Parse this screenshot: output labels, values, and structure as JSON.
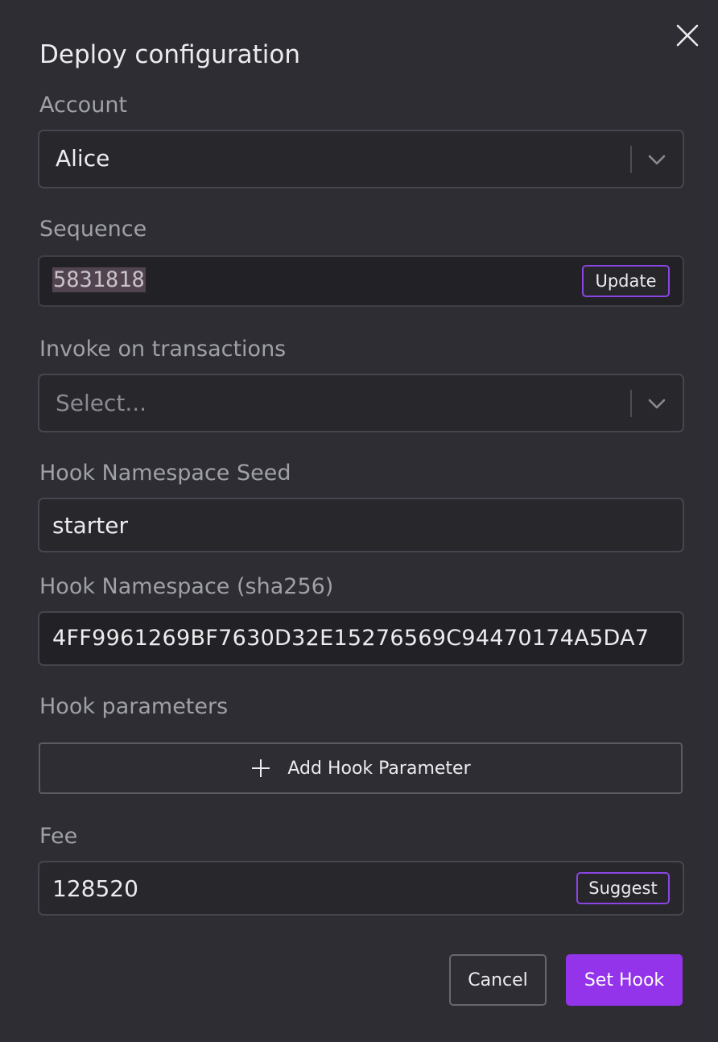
{
  "dialog": {
    "title": "Deploy configuration",
    "close_icon": "close-icon"
  },
  "account": {
    "label": "Account",
    "value": "Alice",
    "icon": "chevron-down-icon"
  },
  "sequence": {
    "label": "Sequence",
    "value": "5831818",
    "button_label": "Update"
  },
  "invoke": {
    "label": "Invoke on transactions",
    "placeholder": "Select...",
    "icon": "chevron-down-icon"
  },
  "namespace_seed": {
    "label": "Hook Namespace Seed",
    "value": "starter"
  },
  "namespace_hash": {
    "label": "Hook Namespace (sha256)",
    "value": "4FF9961269BF7630D32E15276569C94470174A5DA7"
  },
  "hook_parameters": {
    "label": "Hook parameters",
    "add_button_label": "Add Hook Parameter",
    "icon": "plus-icon"
  },
  "fee": {
    "label": "Fee",
    "value": "128520",
    "button_label": "Suggest"
  },
  "footer": {
    "cancel_label": "Cancel",
    "submit_label": "Set Hook"
  },
  "colors": {
    "background": "#2d2d33",
    "accent": "#9333ea",
    "input_background": "#27272c"
  }
}
